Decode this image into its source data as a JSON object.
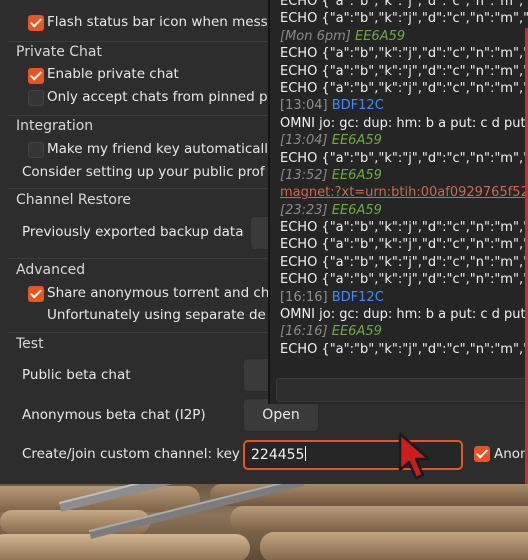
{
  "settings": {
    "top_partial_label": "Flash status bar icon when messa",
    "private_chat": {
      "heading": "Private Chat",
      "enable_label": "Enable private chat",
      "pinned_label": "Only accept chats from pinned pe"
    },
    "integration": {
      "heading": "Integration",
      "friend_key_label": "Make my friend key automatically",
      "public_profile_text": "Consider setting up your public prof"
    },
    "channel_restore": {
      "heading": "Channel Restore",
      "backup_text": "Previously exported backup data"
    },
    "advanced": {
      "heading": "Advanced",
      "share_label": "Share anonymous torrent and ch",
      "note_text": "Unfortunately using separate de"
    },
    "test": {
      "heading": "Test",
      "public_beta_label": "Public beta chat",
      "public_beta_button": "O",
      "anon_beta_label": "Anonymous beta chat (I2P)",
      "anon_beta_button": "Open",
      "custom_channel_label": "Create/join custom channel: key",
      "custom_channel_value": "224455",
      "right_checkbox_label": "Anon"
    }
  },
  "chat": {
    "lines": [
      {
        "type": "msg",
        "text": "ECHO {\"a\":\"b\",\"k\":\"j\",\"d\":\"c\",\"n\":\"m\",\"i\":"
      },
      {
        "type": "msg",
        "text": "ECHO {\"a\":\"b\",\"k\":\"j\",\"d\":\"c\",\"n\":\"m\",\"i\":"
      },
      {
        "type": "ital",
        "ts": "[Mon 6pm]",
        "nick": "EE6A59"
      },
      {
        "type": "msg",
        "text": "ECHO {\"a\":\"b\",\"k\":\"j\",\"d\":\"c\",\"n\":\"m\",\"i\":"
      },
      {
        "type": "msg",
        "text": "ECHO {\"a\":\"b\",\"k\":\"j\",\"d\":\"c\",\"n\":\"m\",\"i\":"
      },
      {
        "type": "msg",
        "text": "ECHO {\"a\":\"b\",\"k\":\"j\",\"d\":\"c\",\"n\":\"m\",\"i\":"
      },
      {
        "type": "plain",
        "ts": "[13:04]",
        "nick": "BDF12C"
      },
      {
        "type": "msg",
        "text": "OMNI jo: gc: dup: hm: b a put: c d put: d"
      },
      {
        "type": "ital",
        "ts": "[13:04]",
        "nick": "EE6A59"
      },
      {
        "type": "msg",
        "text": "ECHO {\"a\":\"b\",\"k\":\"j\",\"d\":\"c\",\"n\":\"m\",\"i\":"
      },
      {
        "type": "ital",
        "ts": "[13:52]",
        "nick": "EE6A59"
      },
      {
        "type": "link",
        "text": "magnet:?xt=urn:btih:00af0929765f52"
      },
      {
        "type": "ital",
        "ts": "[23:23]",
        "nick": "EE6A59"
      },
      {
        "type": "msg",
        "text": "ECHO {\"a\":\"b\",\"k\":\"j\",\"d\":\"c\",\"n\":\"m\",\"i\":"
      },
      {
        "type": "msg",
        "text": "ECHO {\"a\":\"b\",\"k\":\"j\",\"d\":\"c\",\"n\":\"m\",\"i\":"
      },
      {
        "type": "msg",
        "text": "ECHO {\"a\":\"b\",\"k\":\"j\",\"d\":\"c\",\"n\":\"m\",\"i\":"
      },
      {
        "type": "msg",
        "text": "ECHO {\"a\":\"b\",\"k\":\"j\",\"d\":\"c\",\"n\":\"m\",\"i\":"
      },
      {
        "type": "plain",
        "ts": "[16:16]",
        "nick": "BDF12C"
      },
      {
        "type": "msg",
        "text": "OMNI jo: gc: dup: hm: b a put: c d put: d"
      },
      {
        "type": "ital",
        "ts": "[16:16]",
        "nick": "EE6A59"
      },
      {
        "type": "msg",
        "text": "ECHO {\"a\":\"b\",\"k\":\"j\",\"d\":\"c\",\"n\":\"m\",\"i\":"
      }
    ]
  },
  "colors": {
    "accent": "#e95420",
    "nick_green": "#6dac3e",
    "nick_blue": "#3f8ef2",
    "link": "#d0694b"
  }
}
